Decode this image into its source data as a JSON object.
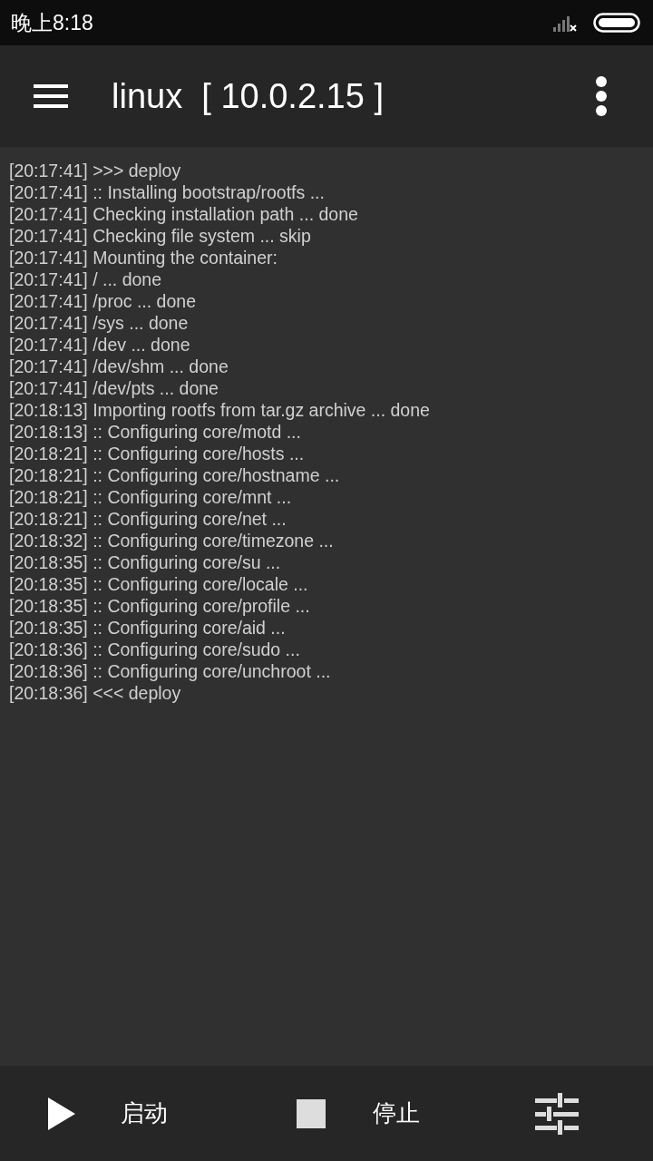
{
  "status_bar": {
    "time": "晚上8:18"
  },
  "app_bar": {
    "title": "linux  [ 10.0.2.15 ]"
  },
  "log": [
    "[20:17:41] >>> deploy",
    "[20:17:41] :: Installing bootstrap/rootfs ...",
    "[20:17:41] Checking installation path ... done",
    "[20:17:41] Checking file system ... skip",
    "[20:17:41] Mounting the container:",
    "[20:17:41] / ... done",
    "[20:17:41] /proc ... done",
    "[20:17:41] /sys ... done",
    "[20:17:41] /dev ... done",
    "[20:17:41] /dev/shm ... done",
    "[20:17:41] /dev/pts ... done",
    "[20:18:13] Importing rootfs from tar.gz archive ... done",
    "[20:18:13] :: Configuring core/motd ...",
    "[20:18:21] :: Configuring core/hosts ...",
    "[20:18:21] :: Configuring core/hostname ...",
    "[20:18:21] :: Configuring core/mnt ...",
    "[20:18:21] :: Configuring core/net ...",
    "[20:18:32] :: Configuring core/timezone ...",
    "[20:18:35] :: Configuring core/su ...",
    "[20:18:35] :: Configuring core/locale ...",
    "[20:18:35] :: Configuring core/profile ...",
    "[20:18:35] :: Configuring core/aid ...",
    "[20:18:36] :: Configuring core/sudo ...",
    "[20:18:36] :: Configuring core/unchroot ...",
    "[20:18:36] <<< deploy"
  ],
  "bottom_bar": [
    {
      "kind": "start",
      "label": "启动"
    },
    {
      "kind": "stop",
      "label": "停止"
    },
    {
      "kind": "settings"
    }
  ]
}
